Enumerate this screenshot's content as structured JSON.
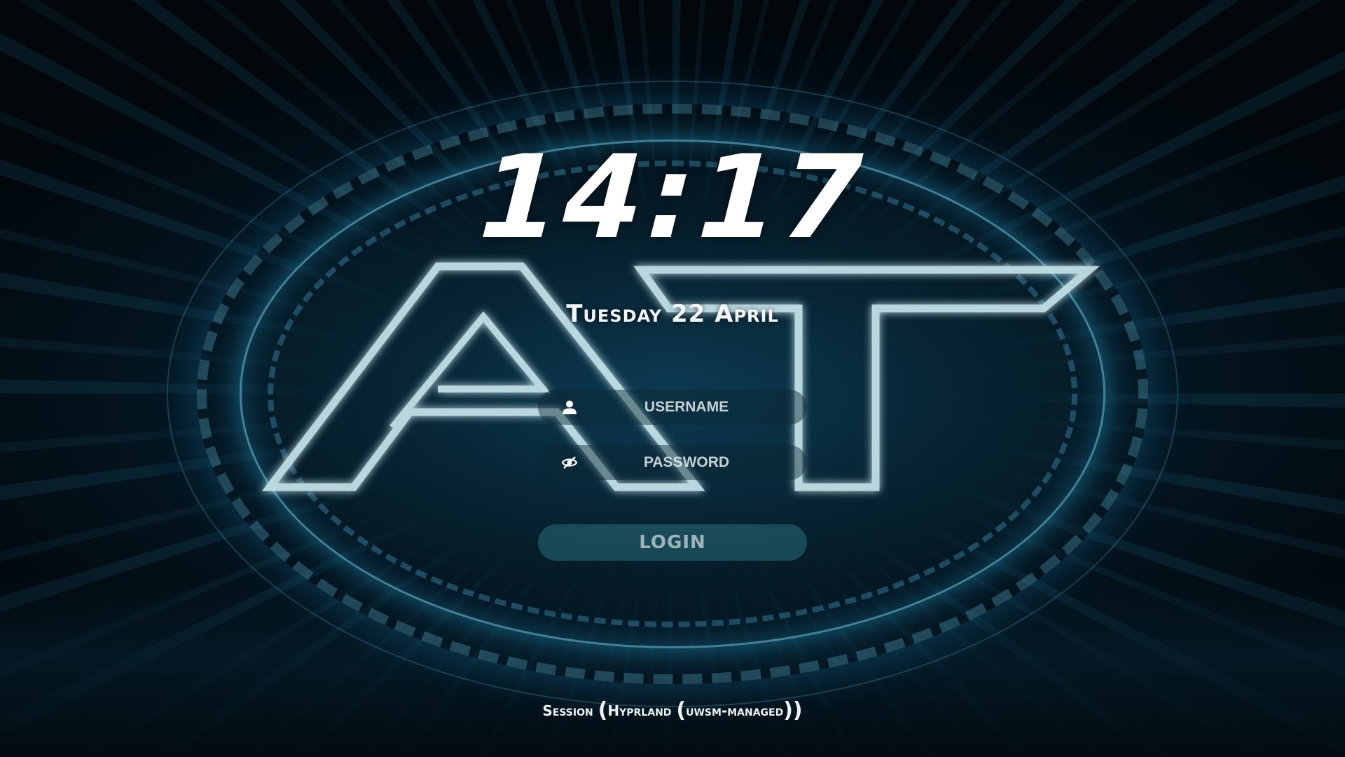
{
  "background": {
    "logo_icon": "at-neon-logo-icon",
    "accent_color": "#3fb4e0",
    "glow_color": "#c8e6ec"
  },
  "clock": {
    "time": "14:17",
    "date": "Tuesday 22 April"
  },
  "login_form": {
    "username_icon": "user-icon",
    "username_placeholder": "USERNAME",
    "password_icon": "eye-slash-icon",
    "password_placeholder": "PASSWORD",
    "login_label": "LOGIN"
  },
  "session": {
    "prefix": "Session",
    "name": "Hyprland",
    "variant": "uwsm-managed"
  }
}
